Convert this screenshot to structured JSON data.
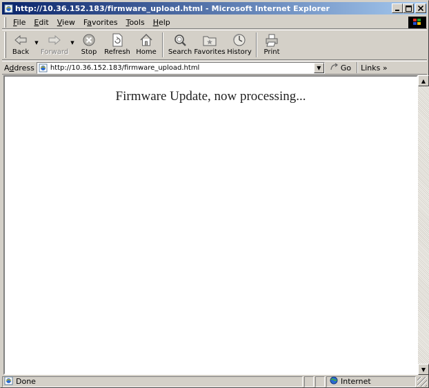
{
  "window": {
    "title": "http://10.36.152.183/firmware_upload.html - Microsoft Internet Explorer"
  },
  "menu": {
    "items": [
      {
        "pre": "",
        "key": "F",
        "post": "ile"
      },
      {
        "pre": "",
        "key": "E",
        "post": "dit"
      },
      {
        "pre": "",
        "key": "V",
        "post": "iew"
      },
      {
        "pre": "F",
        "key": "a",
        "post": "vorites"
      },
      {
        "pre": "",
        "key": "T",
        "post": "ools"
      },
      {
        "pre": "",
        "key": "H",
        "post": "elp"
      }
    ]
  },
  "toolbar": {
    "back": "Back",
    "forward": "Forward",
    "stop": "Stop",
    "refresh": "Refresh",
    "home": "Home",
    "search": "Search",
    "favorites": "Favorites",
    "history": "History",
    "print": "Print"
  },
  "address": {
    "label_pre": "A",
    "label_key": "d",
    "label_post": "dress",
    "url": "http://10.36.152.183/firmware_upload.html",
    "go": "Go",
    "links": "Links »"
  },
  "page": {
    "message": "Firmware Update, now processing..."
  },
  "status": {
    "text": "Done",
    "zone": "Internet"
  },
  "colors": {
    "title_start": "#0a246a",
    "title_end": "#a6caf0",
    "chrome": "#d4d0c8"
  }
}
